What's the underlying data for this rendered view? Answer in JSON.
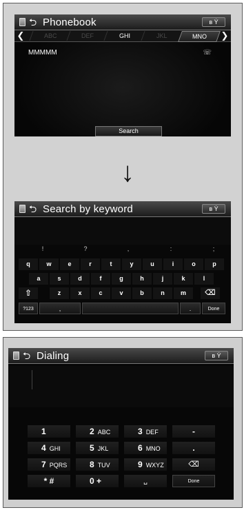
{
  "phonebook": {
    "title": "Phonebook",
    "tabs": [
      "ABC",
      "DEF",
      "GHI",
      "JKL",
      "MNO"
    ],
    "active_tab": "MNO",
    "contact": "MMMMM",
    "search_label": "Search",
    "icons": [
      "phone-icon",
      "back-icon",
      "bluetooth-signal-icon",
      "chevron-left-icon",
      "chevron-right-icon",
      "handset-icon"
    ]
  },
  "keyboard": {
    "title": "Search by keyword",
    "symbols": [
      "!",
      "?",
      ",",
      ":",
      ";"
    ],
    "row1": [
      "q",
      "w",
      "e",
      "r",
      "t",
      "y",
      "u",
      "i",
      "o",
      "p"
    ],
    "row2": [
      "a",
      "s",
      "d",
      "f",
      "g",
      "h",
      "j",
      "k",
      "l"
    ],
    "row3": [
      "z",
      "x",
      "c",
      "v",
      "b",
      "n",
      "m"
    ],
    "mode_key": "?123",
    "comma_key": ",",
    "period_key": ".",
    "done_key": "Done"
  },
  "dialing": {
    "title": "Dialing",
    "keys": [
      {
        "digit": "1",
        "letters": ""
      },
      {
        "digit": "2",
        "letters": "ABC"
      },
      {
        "digit": "3",
        "letters": "DEF"
      },
      {
        "digit": "-",
        "letters": ""
      },
      {
        "digit": "4",
        "letters": "GHI"
      },
      {
        "digit": "5",
        "letters": "JKL"
      },
      {
        "digit": "6",
        "letters": "MNO"
      },
      {
        "digit": ".",
        "letters": ""
      },
      {
        "digit": "7",
        "letters": "PQRS"
      },
      {
        "digit": "8",
        "letters": "TUV"
      },
      {
        "digit": "9",
        "letters": "WXYZ"
      },
      {
        "digit": "",
        "letters": ""
      },
      {
        "digit": "* #",
        "letters": ""
      },
      {
        "digit": "0 +",
        "letters": ""
      },
      {
        "digit": "",
        "letters": ""
      },
      {
        "digit": "",
        "letters": ""
      }
    ],
    "done_key": "Done"
  },
  "status_glyph": "✱",
  "accent_color": "#ffffff"
}
